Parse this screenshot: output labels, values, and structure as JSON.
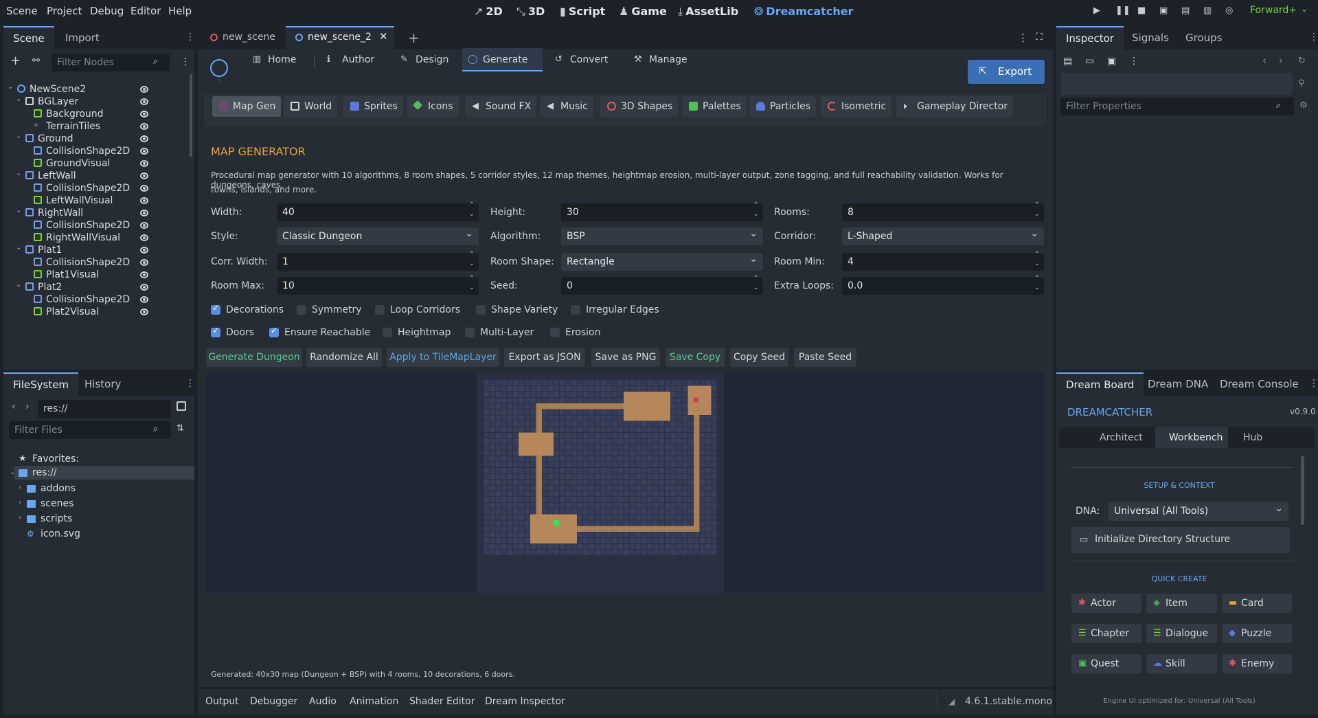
{
  "menu": [
    "Scene",
    "Project",
    "Debug",
    "Editor",
    "Help"
  ],
  "workspaces": {
    "w2d": "2D",
    "w3d": "3D",
    "script": "Script",
    "game": "Game",
    "assetlib": "AssetLib",
    "dream": "Dreamcatcher"
  },
  "renderer": "Forward+",
  "scene_dock": {
    "tabs": [
      "Scene",
      "Import"
    ],
    "filter_placeholder": "Filter Nodes",
    "tree": [
      {
        "label": "NewScene2"
      },
      {
        "label": "BGLayer"
      },
      {
        "label": "Background"
      },
      {
        "label": "TerrainTiles"
      },
      {
        "label": "Ground"
      },
      {
        "label": "CollisionShape2D"
      },
      {
        "label": "GroundVisual"
      },
      {
        "label": "LeftWall"
      },
      {
        "label": "CollisionShape2D"
      },
      {
        "label": "LeftWallVisual"
      },
      {
        "label": "RightWall"
      },
      {
        "label": "CollisionShape2D"
      },
      {
        "label": "RightWallVisual"
      },
      {
        "label": "Plat1"
      },
      {
        "label": "CollisionShape2D"
      },
      {
        "label": "Plat1Visual"
      },
      {
        "label": "Plat2"
      },
      {
        "label": "CollisionShape2D"
      },
      {
        "label": "Plat2Visual"
      }
    ]
  },
  "fs_dock": {
    "tabs": [
      "FileSystem",
      "History"
    ],
    "path": "res://",
    "filter_placeholder": "Filter Files",
    "favorites": "Favorites:",
    "root": "res://",
    "items": [
      "addons",
      "scenes",
      "scripts",
      "icon.svg"
    ]
  },
  "scene_tabs": [
    "new_scene",
    "new_scene_2"
  ],
  "plugin_tabs": {
    "home": "Home",
    "author": "Author",
    "design": "Design",
    "generate": "Generate",
    "convert": "Convert",
    "manage": "Manage",
    "export": "Export"
  },
  "sub_tabs": [
    "Map Gen",
    "World",
    "Sprites",
    "Icons",
    "Sound FX",
    "Music",
    "3D Shapes",
    "Palettes",
    "Particles",
    "Isometric",
    "Gameplay Director"
  ],
  "mapgen": {
    "title": "MAP GENERATOR",
    "desc1": "Procedural map generator with 10 algorithms, 8 room shapes, 5 corridor styles, 12 map themes, heightmap erosion, multi-layer output, zone tagging, and full reachability validation. Works for dungeons, caves,",
    "desc2": "towns, islands, and more.",
    "fields": {
      "width_l": "Width:",
      "width": "40",
      "height_l": "Height:",
      "height": "30",
      "rooms_l": "Rooms:",
      "rooms": "8",
      "style_l": "Style:",
      "style": "Classic Dungeon",
      "algo_l": "Algorithm:",
      "algo": "BSP",
      "corridor_l": "Corridor:",
      "corridor": "L-Shaped",
      "corrw_l": "Corr. Width:",
      "corrw": "1",
      "shape_l": "Room Shape:",
      "shape": "Rectangle",
      "rmin_l": "Room Min:",
      "rmin": "4",
      "rmax_l": "Room Max:",
      "rmax": "10",
      "seed_l": "Seed:",
      "seed": "0",
      "loops_l": "Extra Loops:",
      "loops": "0.0"
    },
    "checks1": [
      {
        "label": "Decorations",
        "on": true
      },
      {
        "label": "Symmetry",
        "on": false
      },
      {
        "label": "Loop Corridors",
        "on": false
      },
      {
        "label": "Shape Variety",
        "on": false
      },
      {
        "label": "Irregular Edges",
        "on": false
      }
    ],
    "checks2": [
      {
        "label": "Doors",
        "on": true
      },
      {
        "label": "Ensure Reachable",
        "on": true
      },
      {
        "label": "Heightmap",
        "on": false
      },
      {
        "label": "Multi-Layer",
        "on": false
      },
      {
        "label": "Erosion",
        "on": false
      }
    ],
    "actions": [
      "Generate Dungeon",
      "Randomize All",
      "Apply to TileMapLayer",
      "Export as JSON",
      "Save as PNG",
      "Save Copy",
      "Copy Seed",
      "Paste Seed"
    ],
    "status": "Generated: 40x30 map (Dungeon + BSP) with 4 rooms, 10 decorations, 6 doors."
  },
  "bottom_tabs": [
    "Output",
    "Debugger",
    "Audio",
    "Animation",
    "Shader Editor",
    "Dream Inspector"
  ],
  "version": "4.6.1.stable.mono",
  "inspector": {
    "tabs": [
      "Inspector",
      "Signals",
      "Groups"
    ],
    "filter_placeholder": "Filter Properties"
  },
  "dream": {
    "tabs": [
      "Dream Board",
      "Dream DNA",
      "Dream Console"
    ],
    "title": "DREAMCATCHER",
    "version": "v0.9.0",
    "subtabs": [
      "Architect",
      "Workbench",
      "Hub"
    ],
    "setup_title": "SETUP & CONTEXT",
    "dna_label": "DNA:",
    "dna_value": "Universal (All Tools)",
    "init_btn": "Initialize Directory Structure",
    "quick_title": "QUICK CREATE",
    "quick": [
      "Actor",
      "Item",
      "Card",
      "Chapter",
      "Dialogue",
      "Puzzle",
      "Quest",
      "Skill",
      "Enemy"
    ],
    "footer": "Engine UI optimized for: Universal (All Tools)"
  },
  "colors": {
    "accent": "#6aa6f0",
    "section_title": "#e8a33d",
    "generate_green": "#4fd38a",
    "apply_blue": "#5aa9e6"
  }
}
